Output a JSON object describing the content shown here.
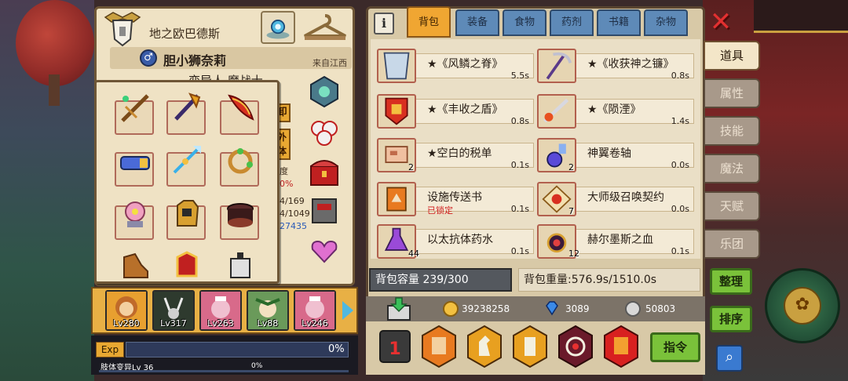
{
  "character": {
    "class_name": "地之欧巴德斯",
    "title": "胆小狮奈莉",
    "origin": "来自江西",
    "subtitle": "变异人 魔战士",
    "side_button_1": "卸",
    "side_button_2": "外体",
    "stat_fragments": [
      "度",
      "0%",
      "4/169",
      "4/1049",
      "27435"
    ]
  },
  "heroes": [
    {
      "level": "Lv280",
      "frame_color": "#e8a030"
    },
    {
      "level": "Lv317",
      "frame_color": "#2e3a2e"
    },
    {
      "level": "Lv263",
      "frame_color": "#d86a8a"
    },
    {
      "level": "Lv88",
      "frame_color": "#6a9a5a"
    },
    {
      "level": "Lv246",
      "frame_color": "#d86a8a"
    }
  ],
  "exp": {
    "label": "Exp",
    "percent": "0%",
    "skill_text": "肢体变异Lv 36",
    "skill_percent": "0%"
  },
  "inventory": {
    "info_label": "i",
    "tabs": [
      "背包",
      "装备",
      "食物",
      "药剂",
      "书籍",
      "杂物"
    ],
    "active_tab": "背包",
    "items": [
      {
        "name": "★《风鳞之脊》",
        "weight": "5.5s",
        "count": ""
      },
      {
        "name": "★《收获神之镰》",
        "weight": "0.8s",
        "count": ""
      },
      {
        "name": "★《丰收之盾》",
        "weight": "0.8s",
        "count": ""
      },
      {
        "name": "★《陨湮》",
        "weight": "1.4s",
        "count": ""
      },
      {
        "name": "★空白的税单",
        "weight": "0.1s",
        "count": "2"
      },
      {
        "name": "神翼卷轴",
        "weight": "0.0s",
        "count": "2"
      },
      {
        "name": "设施传送书",
        "weight": "0.1s",
        "count": "",
        "locked": "已锁定"
      },
      {
        "name": "大师级召唤契约",
        "weight": "0.0s",
        "count": "7"
      },
      {
        "name": "以太抗体药水",
        "weight": "0.1s",
        "count": "44"
      },
      {
        "name": "赫尔墨斯之血",
        "weight": "0.1s",
        "count": "12"
      }
    ],
    "capacity": "背包容量 239/300",
    "weight": "背包重量:576.9s/1510.0s",
    "currency": {
      "gold": "39238258",
      "diamond": "3089",
      "silver": "50803"
    },
    "command_label": "指令"
  },
  "side_tabs": [
    "道具",
    "属性",
    "技能",
    "魔法",
    "天赋",
    "乐团"
  ],
  "active_side_tab": "道具",
  "side_buttons": {
    "arrange": "整理",
    "sort": "排序"
  },
  "colors": {
    "accent_orange": "#f0a632",
    "tab_blue": "#5e8ab8",
    "green_button": "#7ac23a",
    "lock_red": "#d02020"
  }
}
